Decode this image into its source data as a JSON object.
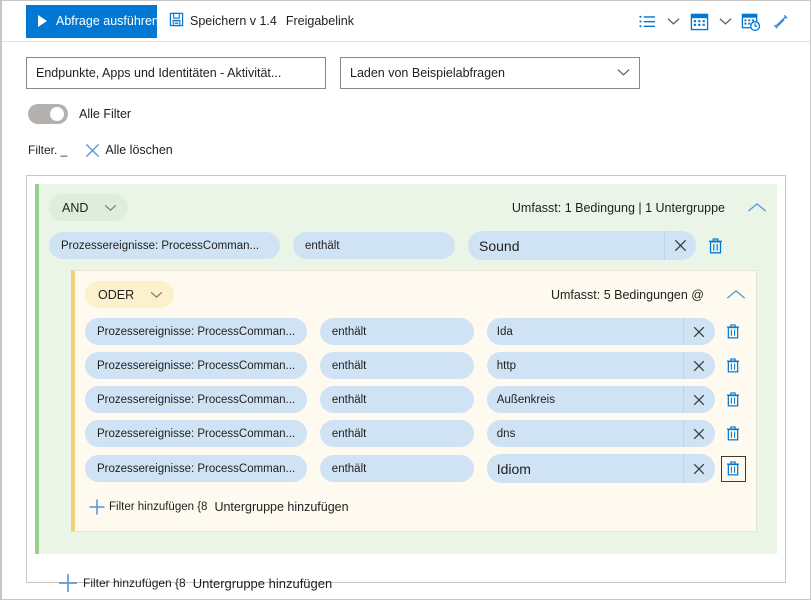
{
  "toolbar": {
    "run_label": "Abfrage ausführen",
    "save_label": "Speichern v 1.4",
    "share_label": "Freigabelink",
    "icons": {
      "run": "play-icon",
      "save": "save-disk-icon",
      "list": "bulleted-list-icon",
      "list_chevron": "chevron-down-icon",
      "calendar": "calendar-icon",
      "calendar_chevron": "chevron-down-icon",
      "calendar_clock": "calendar-clock-icon",
      "edit": "pencil-edit-icon"
    }
  },
  "query": {
    "name_value": "Endpunkte, Apps und Identitäten - Aktivität...",
    "sample_select_value": "Laden von Beispielabfragen"
  },
  "all_filters": {
    "label": "Alle Filter",
    "state": "off"
  },
  "filters_bar": {
    "filters_label": "Filter. _",
    "clear_label": "Alle löschen",
    "clear_icon": "close-x-icon"
  },
  "outer_group": {
    "operator": "AND",
    "summary": "Umfasst: 1 Bedingung | 1 Untergruppe",
    "conditions": [
      {
        "field": "Prozessereignisse: ProcessComman...",
        "operator": "enthält",
        "value": "Sound"
      }
    ],
    "add_filter_label": "Filter hinzufügen {8",
    "add_subgroup_label": "Untergruppe hinzufügen"
  },
  "inner_group": {
    "operator": "ODER",
    "summary": "Umfasst: 5 Bedingungen @",
    "conditions": [
      {
        "field": "Prozessereignisse: ProcessComman...",
        "operator": "enthält",
        "value": "Ida"
      },
      {
        "field": "Prozessereignisse: ProcessComman...",
        "operator": "enthält",
        "value": "http"
      },
      {
        "field": "Prozessereignisse: ProcessComman...",
        "operator": "enthält",
        "value": "Außenkreis"
      },
      {
        "field": "Prozessereignisse: ProcessComman...",
        "operator": "enthält",
        "value": "dns"
      },
      {
        "field": "Prozessereignisse: ProcessComman...",
        "operator": "enthält",
        "value": "Idiom"
      }
    ],
    "add_filter_label": "Filter hinzufügen {8",
    "add_subgroup_label": "Untergruppe hinzufügen"
  },
  "colors": {
    "accent_blue": "#0078d4",
    "pill_blue": "#cfe3f5",
    "and_bg": "#eaf5e8",
    "and_pill": "#ddeedc",
    "and_bar": "#9ad08f",
    "or_bg": "#fefaf0",
    "or_pill": "#fdf0cc",
    "or_bar": "#f2d07a"
  }
}
